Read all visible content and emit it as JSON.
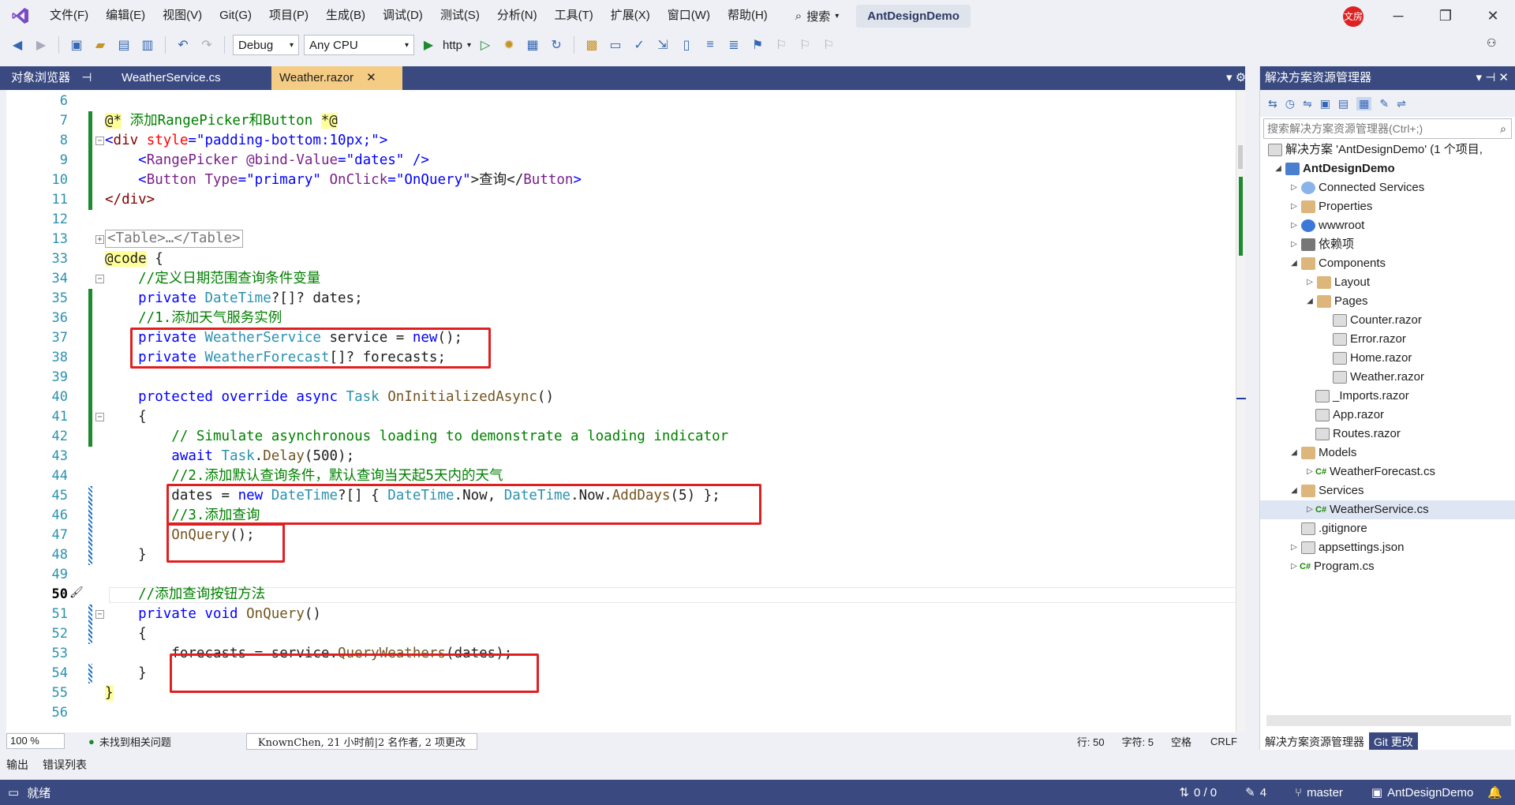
{
  "menubar": {
    "items": [
      "文件(F)",
      "编辑(E)",
      "视图(V)",
      "Git(G)",
      "项目(P)",
      "生成(B)",
      "调试(D)",
      "测试(S)",
      "分析(N)",
      "工具(T)",
      "扩展(X)",
      "窗口(W)",
      "帮助(H)"
    ],
    "search_label": "搜索",
    "solution_name": "AntDesignDemo",
    "avatar_text": "文房"
  },
  "toolbar": {
    "config": "Debug",
    "platform": "Any CPU",
    "run_target": "http"
  },
  "tabs": {
    "object_browser": "对象浏览器",
    "tab1": "WeatherService.cs",
    "tab2": "Weather.razor"
  },
  "editor": {
    "line_numbers": [
      "6",
      "7",
      "8",
      "9",
      "10",
      "11",
      "12",
      "13",
      "33",
      "34",
      "35",
      "36",
      "37",
      "38",
      "39",
      "40",
      "41",
      "42",
      "43",
      "44",
      "45",
      "46",
      "47",
      "48",
      "49",
      "50",
      "51",
      "52",
      "53",
      "54",
      "55",
      "56"
    ],
    "lines": {
      "l7_a": "@*",
      "l7_b": " 添加RangePicker和Button ",
      "l7_c": "*@",
      "l8_a": "<",
      "l8_b": "div",
      "l8_c": " style",
      "l8_d": "=",
      "l8_e": "\"padding-bottom:10px;\"",
      "l8_f": ">",
      "l9_a": "    <",
      "l9_b": "RangePicker",
      "l9_c": " @bind-Value",
      "l9_d": "=",
      "l9_e": "\"dates\"",
      "l9_f": " />",
      "l10_a": "    <",
      "l10_b": "Button",
      "l10_c": " Type",
      "l10_d": "=",
      "l10_e": "\"primary\"",
      "l10_f": " OnClick",
      "l10_g": "=",
      "l10_h": "\"OnQuery\"",
      "l10_i": ">查询</",
      "l10_j": "Button",
      "l10_k": ">",
      "l11": "</div>",
      "l13": "<Table>…</Table>",
      "l34_a": "@code",
      "l34_b": " {",
      "l35": "    //定义日期范围查询条件变量",
      "l36_a": "    private ",
      "l36_b": "DateTime",
      "l36_c": "?[]? dates;",
      "l37": "    //1.添加天气服务实例",
      "l38_a": "    private ",
      "l38_b": "WeatherService",
      "l38_c": " service = ",
      "l38_d": "new",
      "l38_e": "();",
      "l39_a": "    private ",
      "l39_b": "WeatherForecast",
      "l39_c": "[]? forecasts;",
      "l41_a": "    protected override async ",
      "l41_b": "Task",
      "l41_c": " ",
      "l41_d": "OnInitializedAsync",
      "l41_e": "()",
      "l42": "    {",
      "l43": "        // Simulate asynchronous loading to demonstrate a loading indicator",
      "l44_a": "        await ",
      "l44_b": "Task",
      "l44_c": ".",
      "l44_d": "Delay",
      "l44_e": "(500);",
      "l45": "        //2.添加默认查询条件，默认查询当天起5天内的天气",
      "l46_a": "        dates = ",
      "l46_b": "new",
      "l46_c": " ",
      "l46_d": "DateTime",
      "l46_e": "?[] { ",
      "l46_f": "DateTime",
      "l46_g": ".Now, ",
      "l46_h": "DateTime",
      "l46_i": ".Now.",
      "l46_j": "AddDays",
      "l46_k": "(5) };",
      "l47": "        //3.添加查询",
      "l48_a": "        ",
      "l48_b": "OnQuery",
      "l48_c": "();",
      "l49": "    }",
      "l51": "    //添加查询按钮方法",
      "l52_a": "    private void ",
      "l52_b": "OnQuery",
      "l52_c": "()",
      "l53": "    {",
      "l54_a": "        forecasts = service.",
      "l54_b": "QueryWeathers",
      "l54_c": "(dates);",
      "l55": "    }",
      "l56": "}"
    }
  },
  "editor_status": {
    "zoom": "100 %",
    "issues": "未找到相关问题",
    "codelens": "KnownChen, 21 小时前|2 名作者, 2 项更改",
    "line": "行: 50",
    "col": "字符: 5",
    "whitespace": "空格",
    "eol": "CRLF"
  },
  "explorer": {
    "title": "解决方案资源管理器",
    "search_placeholder": "搜索解决方案资源管理器(Ctrl+;)",
    "tree": [
      "解决方案 'AntDesignDemo' (1 个项目,",
      "AntDesignDemo",
      "Connected Services",
      "Properties",
      "wwwroot",
      "依赖项",
      "Components",
      "Layout",
      "Pages",
      "Counter.razor",
      "Error.razor",
      "Home.razor",
      "Weather.razor",
      "_Imports.razor",
      "App.razor",
      "Routes.razor",
      "Models",
      "WeatherForecast.cs",
      "Services",
      "WeatherService.cs",
      ".gitignore",
      "appsettings.json",
      "Program.cs"
    ],
    "bottom_tab1": "解决方案资源管理器",
    "bottom_tab2": "Git 更改"
  },
  "bottom_panel": {
    "output": "输出",
    "errors": "错误列表"
  },
  "statusbar": {
    "ready": "就绪",
    "sync": "0 / 0",
    "pencil": "4",
    "branch": "master",
    "repo": "AntDesignDemo"
  },
  "colors": {
    "accent": "#3a4a80",
    "active_tab": "#f5cc84",
    "highlight_box": "#e02020"
  }
}
